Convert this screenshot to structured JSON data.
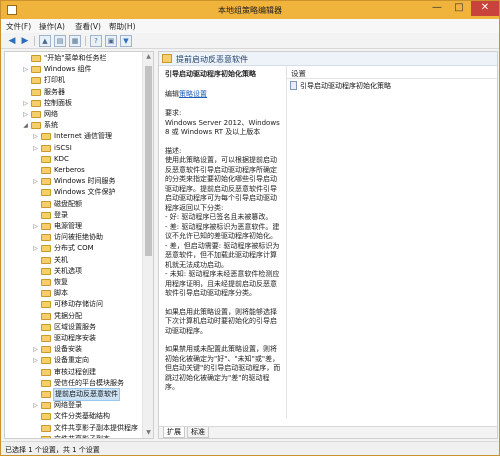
{
  "window": {
    "title": "本地组策略编辑器",
    "controls": {
      "minimize": "—",
      "maximize": "□",
      "close": "✕"
    }
  },
  "menubar": [
    "文件(F)",
    "操作(A)",
    "查看(V)",
    "帮助(H)"
  ],
  "toolbar": {
    "back": "◀",
    "forward": "▶"
  },
  "tree": {
    "items": [
      {
        "label": "\"开始\"菜单和任务栏",
        "indent": 2,
        "arrow": ""
      },
      {
        "label": "Windows 组件",
        "indent": 2,
        "arrow": "▷"
      },
      {
        "label": "打印机",
        "indent": 2,
        "arrow": ""
      },
      {
        "label": "服务器",
        "indent": 2,
        "arrow": ""
      },
      {
        "label": "控制面板",
        "indent": 2,
        "arrow": "▷"
      },
      {
        "label": "网络",
        "indent": 2,
        "arrow": "▷"
      },
      {
        "label": "系统",
        "indent": 2,
        "arrow": "◢"
      },
      {
        "label": "Internet 通信管理",
        "indent": 3,
        "arrow": "▷"
      },
      {
        "label": "iSCSI",
        "indent": 3,
        "arrow": "▷"
      },
      {
        "label": "KDC",
        "indent": 3,
        "arrow": ""
      },
      {
        "label": "Kerberos",
        "indent": 3,
        "arrow": ""
      },
      {
        "label": "Windows 时间服务",
        "indent": 3,
        "arrow": "▷"
      },
      {
        "label": "Windows 文件保护",
        "indent": 3,
        "arrow": ""
      },
      {
        "label": "磁盘配额",
        "indent": 3,
        "arrow": ""
      },
      {
        "label": "登录",
        "indent": 3,
        "arrow": ""
      },
      {
        "label": "电源管理",
        "indent": 3,
        "arrow": "▷"
      },
      {
        "label": "访问被拒绝协助",
        "indent": 3,
        "arrow": ""
      },
      {
        "label": "分布式 COM",
        "indent": 3,
        "arrow": "▷"
      },
      {
        "label": "关机",
        "indent": 3,
        "arrow": ""
      },
      {
        "label": "关机选项",
        "indent": 3,
        "arrow": ""
      },
      {
        "label": "恢复",
        "indent": 3,
        "arrow": ""
      },
      {
        "label": "脚本",
        "indent": 3,
        "arrow": ""
      },
      {
        "label": "可移动存储访问",
        "indent": 3,
        "arrow": ""
      },
      {
        "label": "凭据分配",
        "indent": 3,
        "arrow": ""
      },
      {
        "label": "区域设置服务",
        "indent": 3,
        "arrow": ""
      },
      {
        "label": "驱动程序安装",
        "indent": 3,
        "arrow": ""
      },
      {
        "label": "设备安装",
        "indent": 3,
        "arrow": "▷"
      },
      {
        "label": "设备重定向",
        "indent": 3,
        "arrow": "▷"
      },
      {
        "label": "审核过程创建",
        "indent": 3,
        "arrow": ""
      },
      {
        "label": "受信任的平台模块服务",
        "indent": 3,
        "arrow": ""
      },
      {
        "label": "提前启动反恶意软件",
        "indent": 3,
        "arrow": "",
        "selected": true
      },
      {
        "label": "网络登录",
        "indent": 3,
        "arrow": "▷"
      },
      {
        "label": "文件分类基础结构",
        "indent": 3,
        "arrow": ""
      },
      {
        "label": "文件共享影子副本提供程序",
        "indent": 3,
        "arrow": ""
      },
      {
        "label": "文件共享影子副本",
        "indent": 3,
        "arrow": ""
      }
    ]
  },
  "right_panel": {
    "folder_title": "提前启动反恶意软件",
    "description": {
      "policy_title": "引导启动驱动程序初始化策略",
      "edit_prefix": "编辑",
      "edit_link": "策略设置",
      "paragraphs": [
        "要求:\nWindows Server 2012、Windows 8 或 Windows RT 及以上版本",
        "描述:\n使用此策略设置，可以根据提前启动反恶意软件引导启动驱动程序所确定的分类来指定要初始化哪些引导启动驱动程序。提前启动反恶意软件引导启动驱动程序可为每个引导启动驱动程序返回以下分类:\n- 好: 驱动程序已签名且未被篡改。\n- 差: 驱动程序被标识为恶意软件。建议不允许已知的差驱动程序初始化。\n- 差，但启动需要: 驱动程序被标识为恶意软件，但不加载此驱动程序计算机就无法成功启动。\n- 未知: 驱动程序未经恶意软件检测应用程序证明，且未经提前启动反恶意软件引导启动驱动程序分类。",
        "如果启用此策略设置，则将能够选择下次计算机启动时要初始化的引导启动驱动程序。",
        "如果禁用或未配置此策略设置，则将初始化被确定为\"好\"、\"未知\"或\"差，但启动关键\"的引导启动驱动程序，而跳过初始化被确定为\"差\"的驱动程序。"
      ]
    },
    "settings_header": "设置",
    "settings_items": [
      "引导启动驱动程序初始化策略"
    ],
    "tabs": [
      "扩展",
      "标准"
    ]
  },
  "statusbar": {
    "text": "已选择 1 个设置，共 1 个设置"
  }
}
